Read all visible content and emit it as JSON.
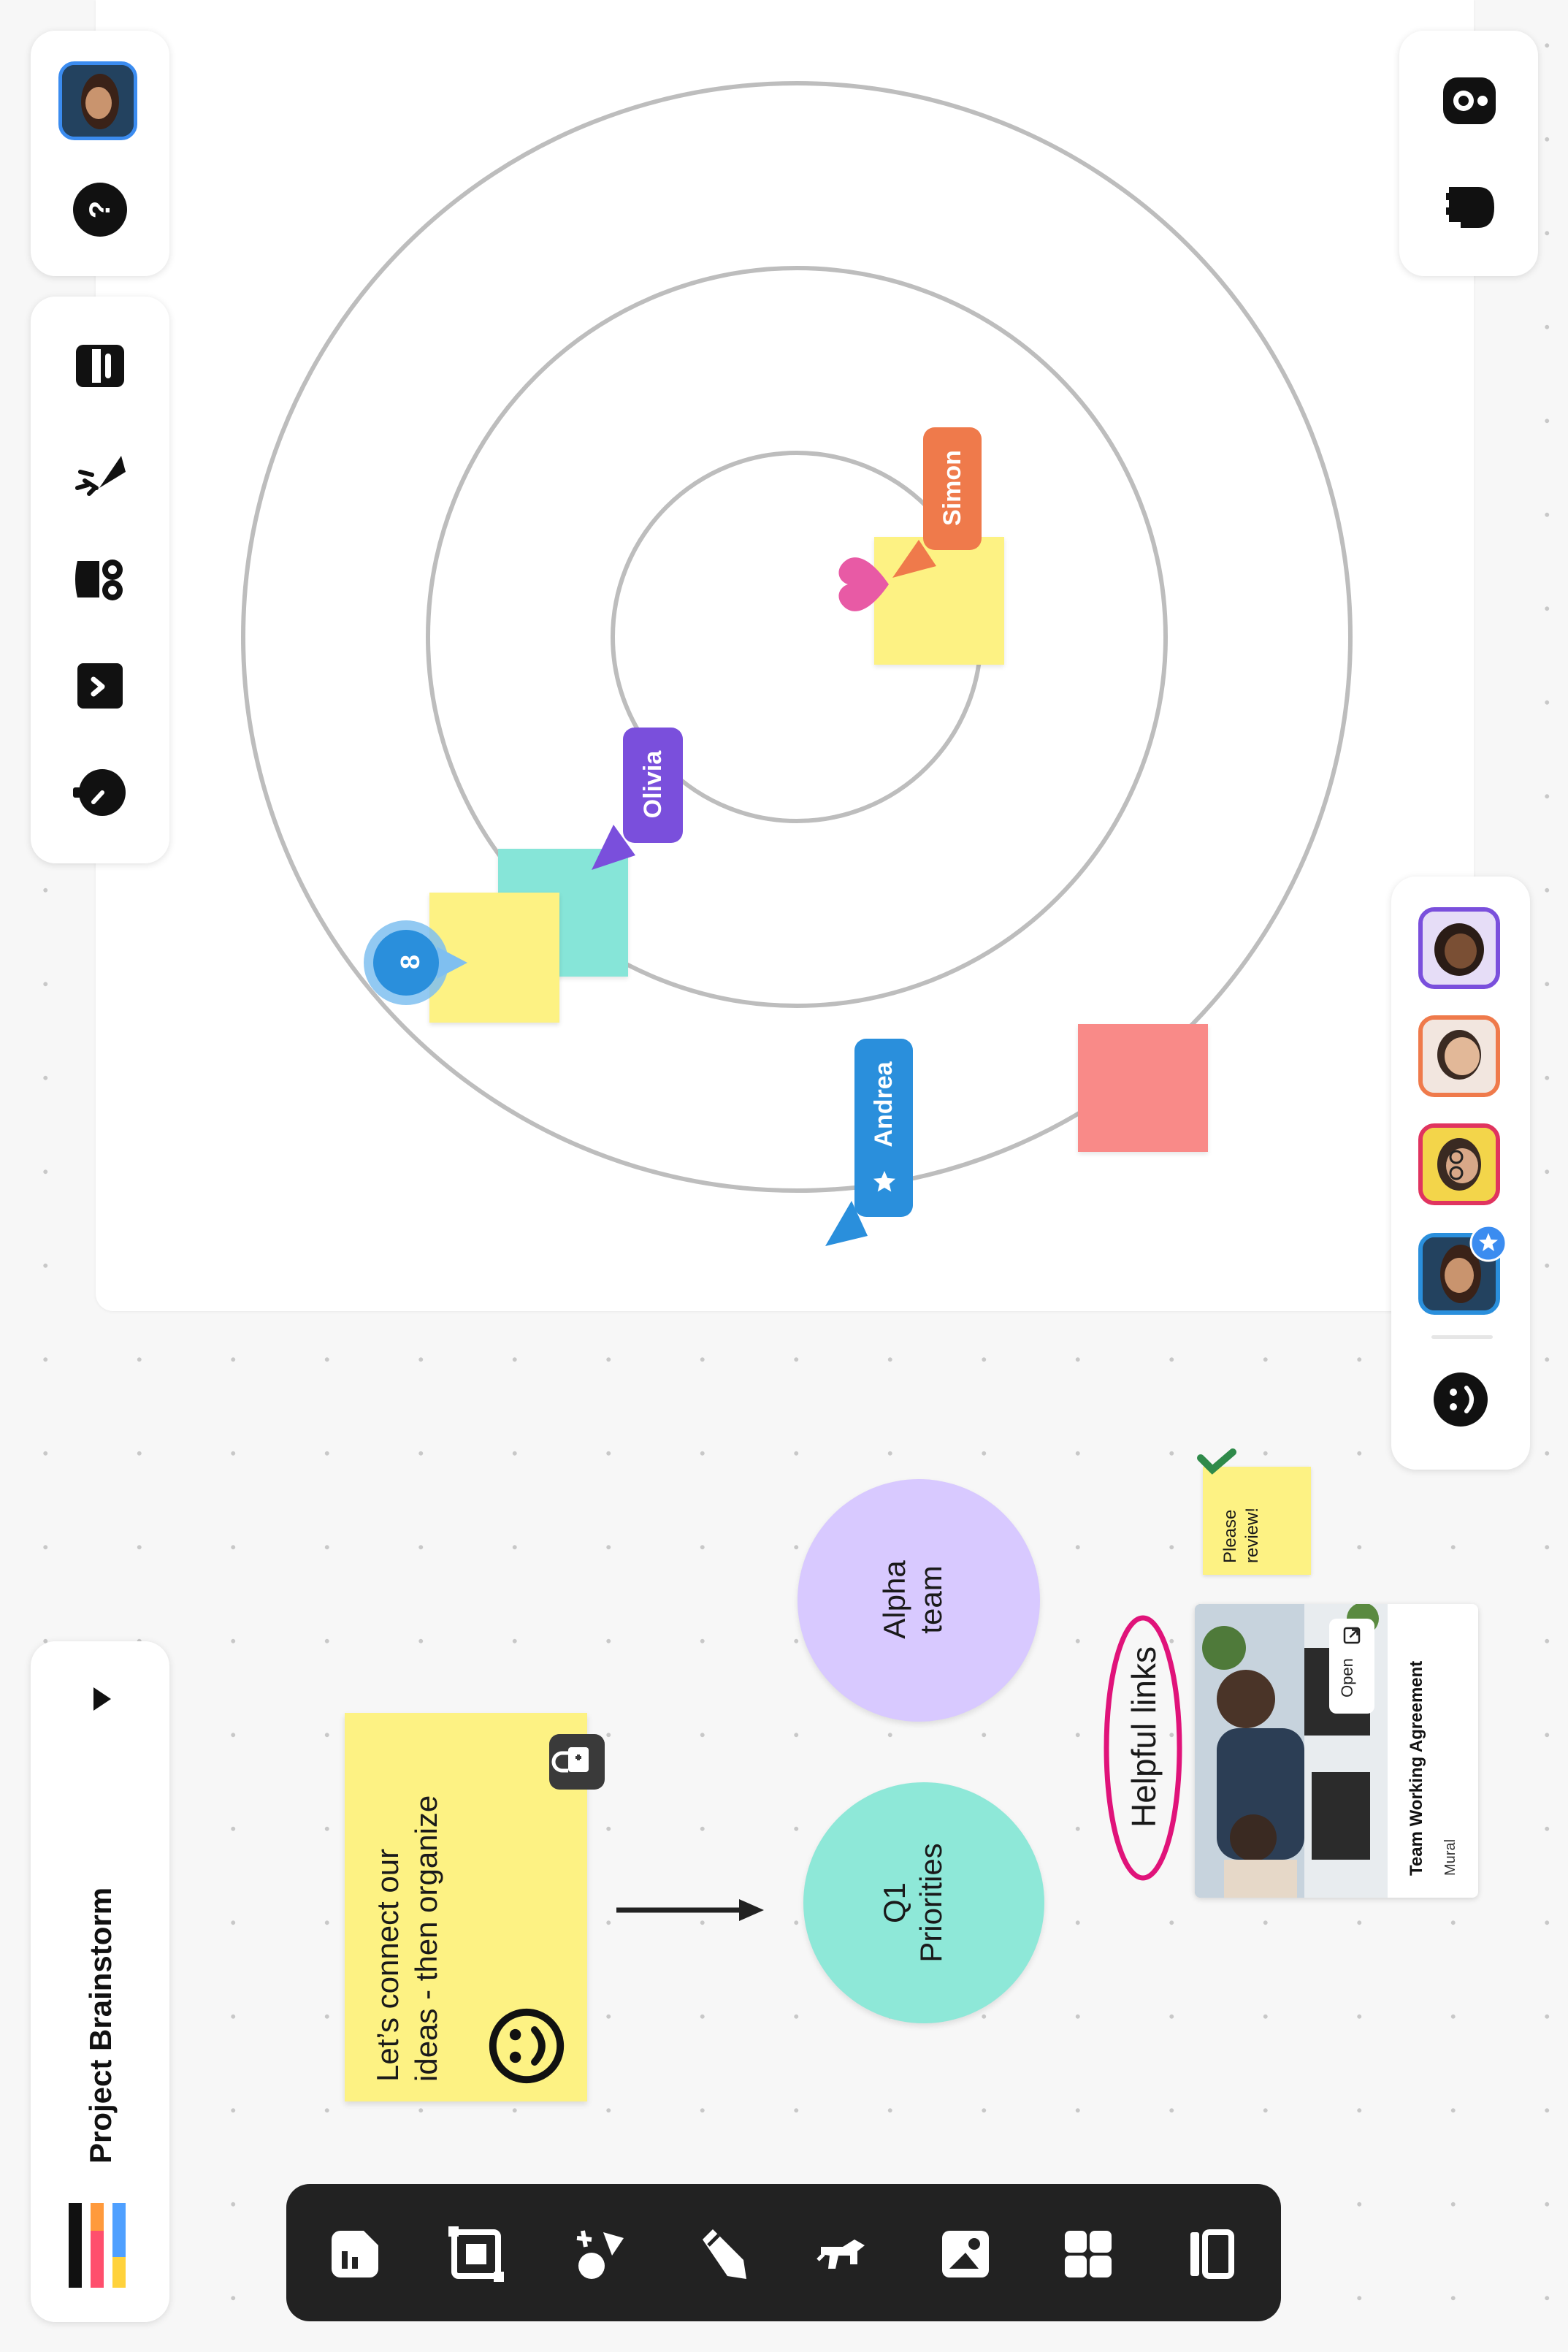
{
  "board": {
    "title": "Project Brainstorm",
    "colors": {
      "yellow": "#fdf283",
      "teal": "#86e5d8",
      "salmon": "#f98a88",
      "lavender": "#d8c9ff",
      "mint": "#8ee8d8",
      "pink": "#e0137a",
      "toolbar": "#222222"
    }
  },
  "cursors": [
    {
      "name": "Simon",
      "color": "#ef7a4b"
    },
    {
      "name": "Olivia",
      "color": "#7a4fdc"
    },
    {
      "name": "Andrea",
      "color": "#2a8fdc"
    }
  ],
  "badge": {
    "count": "8"
  },
  "sticky_main": {
    "line1": "Let’s connect our",
    "line2": "ideas - then organize"
  },
  "circles": {
    "priorities": {
      "line1": "Q1",
      "line2": "Priorities"
    },
    "alpha": {
      "line1": "Alpha",
      "line2": "team"
    }
  },
  "review_note": {
    "line1": "Please",
    "line2": "review!"
  },
  "helpful_links": "Helpful links",
  "link_card": {
    "title": "Team Working Agreement",
    "source": "Mural",
    "open_label": "Open"
  },
  "left_top_icons": [
    "user-avatar",
    "help-icon"
  ],
  "left_tools": [
    "outline-icon",
    "celebrate-icon",
    "private-mode-icon",
    "voting-icon",
    "timer-icon"
  ],
  "right_top_icons": [
    "summon-icon",
    "hand-icon"
  ],
  "collaborators": [
    "collaborator-1",
    "collaborator-2",
    "collaborator-3",
    "collaborator-4-facilitator"
  ],
  "bottom_toolbar": [
    "templates-icon",
    "frame-icon",
    "shapes-icon",
    "draw-icon",
    "gif-icon",
    "image-icon",
    "grid-icon",
    "columns-icon"
  ]
}
